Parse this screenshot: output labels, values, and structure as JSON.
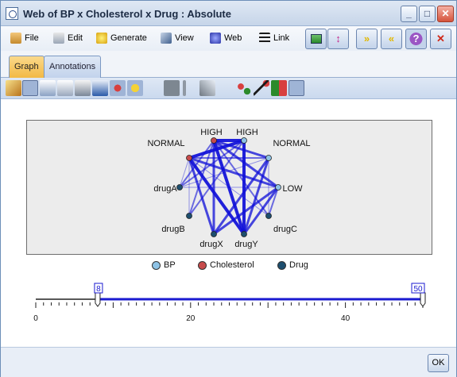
{
  "window": {
    "title": "Web of BP x Cholesterol x Drug : Absolute"
  },
  "window_controls": {
    "minimize": "_",
    "maximize": "□",
    "close": "✕"
  },
  "menu": {
    "file": "File",
    "edit": "Edit",
    "generate": "Generate",
    "view": "View",
    "web": "Web",
    "link": "Link"
  },
  "right_toolbar": {
    "forward": "»",
    "back": "«",
    "help": "?",
    "close": "✕"
  },
  "tabs": [
    {
      "label": "Graph"
    },
    {
      "label": "Annotations"
    }
  ],
  "graph": {
    "nodes": [
      {
        "id": "bp_high",
        "label": "HIGH",
        "group": "BP"
      },
      {
        "id": "bp_normal",
        "label": "NORMAL",
        "group": "BP"
      },
      {
        "id": "bp_low",
        "label": "LOW",
        "group": "BP"
      },
      {
        "id": "chol_high",
        "label": "HIGH",
        "group": "Cholesterol"
      },
      {
        "id": "chol_normal",
        "label": "NORMAL",
        "group": "Cholesterol"
      },
      {
        "id": "drugA",
        "label": "drugA",
        "group": "Drug"
      },
      {
        "id": "drugB",
        "label": "drugB",
        "group": "Drug"
      },
      {
        "id": "drugC",
        "label": "drugC",
        "group": "Drug"
      },
      {
        "id": "drugX",
        "label": "drugX",
        "group": "Drug"
      },
      {
        "id": "drugY",
        "label": "drugY",
        "group": "Drug"
      }
    ],
    "links": [
      {
        "a": "chol_high",
        "b": "bp_high",
        "w": 4
      },
      {
        "a": "chol_high",
        "b": "bp_normal",
        "w": 3
      },
      {
        "a": "chol_high",
        "b": "bp_low",
        "w": 3
      },
      {
        "a": "chol_high",
        "b": "drugX",
        "w": 3
      },
      {
        "a": "chol_high",
        "b": "drugY",
        "w": 4
      },
      {
        "a": "chol_high",
        "b": "drugA",
        "w": 2
      },
      {
        "a": "chol_high",
        "b": "drugB",
        "w": 2
      },
      {
        "a": "chol_high",
        "b": "drugC",
        "w": 2
      },
      {
        "a": "chol_normal",
        "b": "bp_high",
        "w": 4
      },
      {
        "a": "chol_normal",
        "b": "drugY",
        "w": 4
      },
      {
        "a": "chol_normal",
        "b": "drugX",
        "w": 3
      },
      {
        "a": "chol_normal",
        "b": "bp_low",
        "w": 3
      },
      {
        "a": "chol_normal",
        "b": "bp_normal",
        "w": 2
      },
      {
        "a": "chol_normal",
        "b": "drugA",
        "w": 1
      },
      {
        "a": "chol_normal",
        "b": "drugB",
        "w": 1
      },
      {
        "a": "chol_normal",
        "b": "drugC",
        "w": 1
      },
      {
        "a": "bp_high",
        "b": "drugY",
        "w": 4
      },
      {
        "a": "bp_high",
        "b": "drugA",
        "w": 2
      },
      {
        "a": "bp_high",
        "b": "drugB",
        "w": 2
      },
      {
        "a": "bp_low",
        "b": "drugY",
        "w": 3
      },
      {
        "a": "bp_low",
        "b": "drugX",
        "w": 3
      },
      {
        "a": "bp_low",
        "b": "drugC",
        "w": 2
      },
      {
        "a": "bp_low",
        "b": "drugA",
        "w": 1
      },
      {
        "a": "bp_normal",
        "b": "drugX",
        "w": 3
      },
      {
        "a": "bp_normal",
        "b": "drugY",
        "w": 3
      },
      {
        "a": "bp_normal",
        "b": "drugA",
        "w": 1
      },
      {
        "a": "bp_normal",
        "b": "drugC",
        "w": 1
      }
    ],
    "colors": {
      "BP": "#8ec3e6",
      "Cholesterol": "#c74b4b",
      "Drug": "#1d4e6e",
      "link": "#1010d8"
    }
  },
  "legend": [
    {
      "label": "BP",
      "color": "#8ec3e6"
    },
    {
      "label": "Cholesterol",
      "color": "#c74b4b"
    },
    {
      "label": "Drug",
      "color": "#1d4e6e"
    }
  ],
  "slider": {
    "min_value": 8,
    "max_value": 50,
    "scale_labels": [
      "0",
      "20",
      "40"
    ],
    "min_label": "8",
    "max_label": "50"
  },
  "footer": {
    "ok": "OK"
  }
}
